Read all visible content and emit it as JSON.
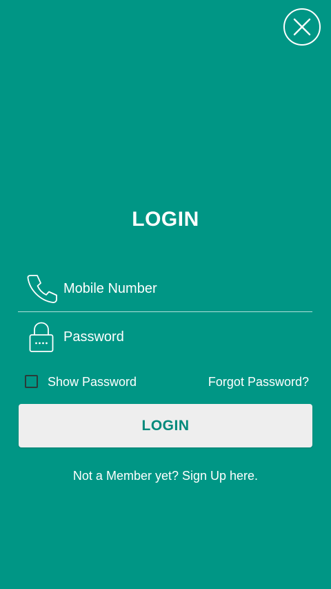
{
  "colors": {
    "background": "#009685",
    "button_bg": "#eeeeee",
    "button_text": "#00897b",
    "text": "#ffffff"
  },
  "header": {
    "close_icon": "close-icon"
  },
  "title": "LOGIN",
  "form": {
    "mobile": {
      "icon": "phone-icon",
      "placeholder": "Mobile Number",
      "value": ""
    },
    "password": {
      "icon": "lock-icon",
      "placeholder": "Password",
      "value": ""
    },
    "show_password": {
      "label": "Show Password",
      "checked": false
    },
    "forgot_password": "Forgot Password?",
    "submit_label": "LOGIN"
  },
  "signup_text": "Not a Member yet? Sign Up here."
}
